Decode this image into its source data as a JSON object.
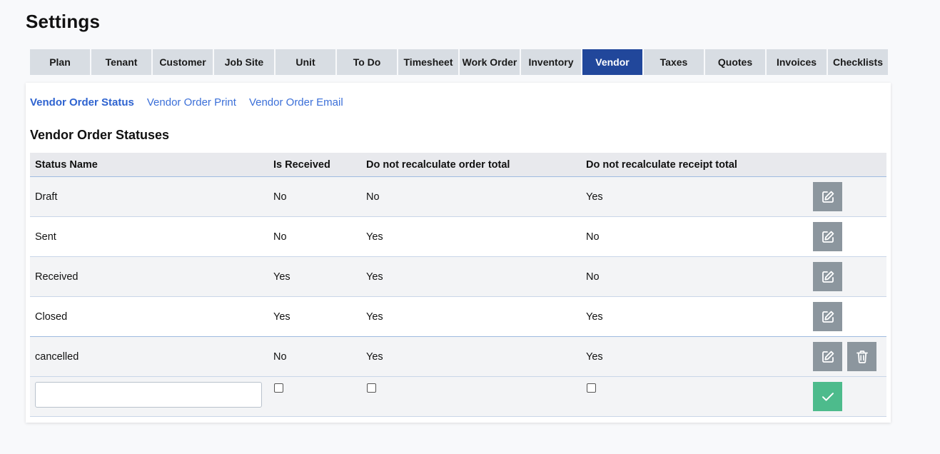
{
  "page": {
    "title": "Settings"
  },
  "tabs": [
    {
      "label": "Plan"
    },
    {
      "label": "Tenant"
    },
    {
      "label": "Customer"
    },
    {
      "label": "Job Site"
    },
    {
      "label": "Unit"
    },
    {
      "label": "To Do"
    },
    {
      "label": "Timesheet"
    },
    {
      "label": "Work Order"
    },
    {
      "label": "Inventory"
    },
    {
      "label": "Vendor",
      "active": true
    },
    {
      "label": "Taxes"
    },
    {
      "label": "Quotes"
    },
    {
      "label": "Invoices"
    },
    {
      "label": "Checklists"
    }
  ],
  "subtabs": [
    {
      "label": "Vendor Order Status",
      "active": true
    },
    {
      "label": "Vendor Order Print"
    },
    {
      "label": "Vendor Order Email"
    }
  ],
  "section": {
    "title": "Vendor Order Statuses"
  },
  "table": {
    "columns": [
      "Status Name",
      "Is Received",
      "Do not recalculate order total",
      "Do not recalculate receipt total"
    ],
    "rows": [
      {
        "name": "Draft",
        "is_received": "No",
        "no_recalc_order": "No",
        "no_recalc_receipt": "Yes"
      },
      {
        "name": "Sent",
        "is_received": "No",
        "no_recalc_order": "Yes",
        "no_recalc_receipt": "No"
      },
      {
        "name": "Received",
        "is_received": "Yes",
        "no_recalc_order": "Yes",
        "no_recalc_receipt": "No"
      },
      {
        "name": "Closed",
        "is_received": "Yes",
        "no_recalc_order": "Yes",
        "no_recalc_receipt": "Yes"
      },
      {
        "name": "cancelled",
        "is_received": "No",
        "no_recalc_order": "Yes",
        "no_recalc_receipt": "Yes",
        "deletable": true
      }
    ],
    "new_row": {
      "name_value": "",
      "name_placeholder": "",
      "is_received": false,
      "no_recalc_order": false,
      "no_recalc_receipt": false
    }
  },
  "icons": {
    "edit": "edit-icon",
    "delete": "trash-icon",
    "save": "check-icon"
  },
  "colors": {
    "active_tab": "#21479b",
    "link": "#3b6fd8",
    "action_button": "#8c969e",
    "save_button": "#4dbb8c"
  }
}
